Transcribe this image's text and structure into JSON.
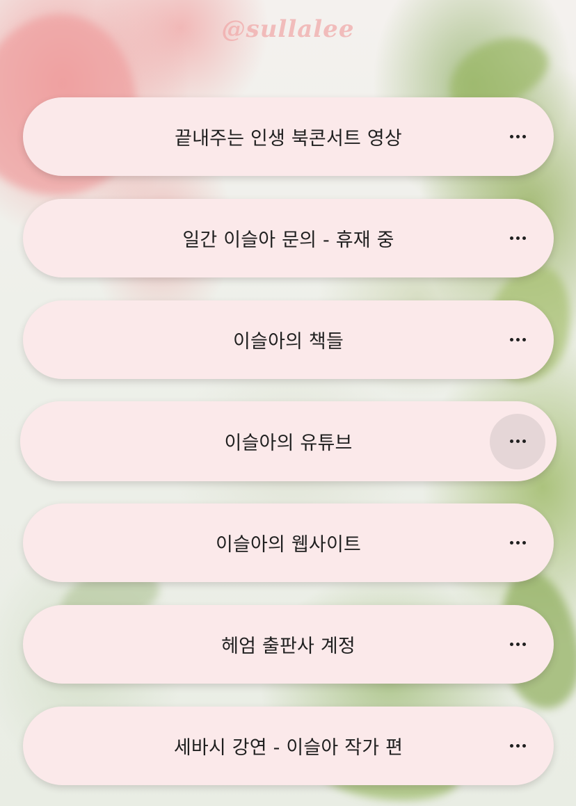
{
  "profile": {
    "watermark": "@sullalee"
  },
  "links": [
    {
      "label": "끝내주는 인생 북콘서트 영상",
      "more_icon": "more-horizontal-icon",
      "active": false
    },
    {
      "label": "일간 이슬아 문의 - 휴재 중",
      "more_icon": "more-horizontal-icon",
      "active": false
    },
    {
      "label": "이슬아의 책들",
      "more_icon": "more-horizontal-icon",
      "active": false
    },
    {
      "label": "이슬아의 유튜브",
      "more_icon": "more-horizontal-icon",
      "active": true
    },
    {
      "label": "이슬아의 웹사이트",
      "more_icon": "more-horizontal-icon",
      "active": false
    },
    {
      "label": "헤엄 출판사 계정",
      "more_icon": "more-horizontal-icon",
      "active": false
    },
    {
      "label": "세바시 강연 - 이슬아 작가 편",
      "more_icon": "more-horizontal-icon",
      "active": false
    }
  ],
  "colors": {
    "button_bg": "#fbe9ea",
    "button_text": "#1f1f1f",
    "active_more_bg": "#e5d6d7",
    "watermark": "#f0aaaa"
  }
}
